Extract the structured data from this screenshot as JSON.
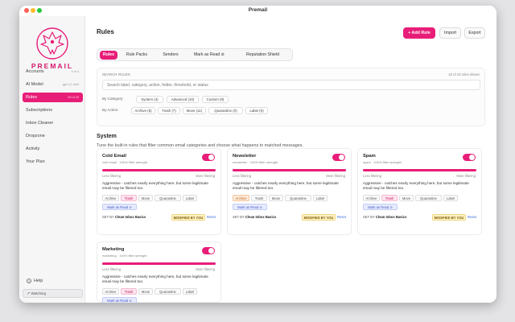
{
  "window": {
    "title": "Premail"
  },
  "colors": {
    "accent": "#e81d78",
    "toggle_on": "#e81d78",
    "link": "#3a6fd6",
    "modified_badge": "#fff3c6"
  },
  "sidebar": {
    "logo_text": "PREMAIL",
    "items": [
      {
        "label": "Accounts",
        "sub": "4 of 4",
        "active": false
      },
      {
        "label": "AI Model",
        "sub": "gpt-4.1-mini",
        "active": false
      },
      {
        "label": "Rules",
        "sub": "23 of 23",
        "active": true
      },
      {
        "label": "Subscriptions",
        "sub": "",
        "active": false
      },
      {
        "label": "Inbox Cleaner",
        "sub": "",
        "active": false
      },
      {
        "label": "Dropzone",
        "sub": "",
        "active": false
      },
      {
        "label": "Activity",
        "sub": "",
        "active": false
      },
      {
        "label": "Your Plan",
        "sub": "",
        "active": false
      }
    ],
    "help_label": "Help",
    "help_icon": "?",
    "status_text": "Watching"
  },
  "header": {
    "title": "Rules",
    "add_rule_label": "+ Add Rule",
    "import_label": "Import",
    "export_label": "Export"
  },
  "tabs": [
    {
      "label": "Rules",
      "active": true
    },
    {
      "label": "Rule Packs",
      "active": false
    },
    {
      "label": "Senders",
      "active": false
    },
    {
      "label": "Mark as Read ⊘",
      "active": false
    },
    {
      "label": "Reputation Shield",
      "active": false
    }
  ],
  "search": {
    "label": "SEARCH RULES",
    "count_text": "23 of 23 rules shown",
    "placeholder": "Search label, category, action, folder, threshold, or status"
  },
  "filters": {
    "category_label": "By Category:",
    "categories": [
      "System (4)",
      "Advanced (10)",
      "Custom (9)"
    ],
    "action_label": "By Action:",
    "actions": [
      "Archive (5)",
      "Trash (7)",
      "Move (11)",
      "Quarantine (0)",
      "Label (0)"
    ]
  },
  "section": {
    "title": "System",
    "description": "Tune the built-in rules that filter common email categories and choose what happens to matched messages."
  },
  "cards": [
    {
      "title": "Cold Email",
      "subtitle": "cold email · 100% filter strength",
      "enabled": true,
      "strength": 1.0,
      "slider_left": "Less filtering",
      "slider_right": "More filtering",
      "description": "Aggressive - catches nearly everything here, but some legitimate email may be filtered too.",
      "actions": [
        {
          "label": "Archive",
          "style": ""
        },
        {
          "label": "Trash",
          "style": "red"
        },
        {
          "label": "Move",
          "style": ""
        },
        {
          "label": "Quarantine",
          "style": ""
        },
        {
          "label": "Label",
          "style": ""
        }
      ],
      "mark_read": "Mark as Read ⊘",
      "set_by_label": "SET BY",
      "set_by_value": "Clean Inbox Basics",
      "modified_label": "MODIFIED BY YOU",
      "reset_label": "Reset"
    },
    {
      "title": "Newsletter",
      "subtitle": "newsletter · 100% filter strength",
      "enabled": true,
      "strength": 1.0,
      "slider_left": "Less filtering",
      "slider_right": "More filtering",
      "description": "Aggressive - catches nearly everything here, but some legitimate email may be filtered too.",
      "actions": [
        {
          "label": "Archive",
          "style": "orange"
        },
        {
          "label": "Trash",
          "style": ""
        },
        {
          "label": "Move",
          "style": ""
        },
        {
          "label": "Quarantine",
          "style": ""
        },
        {
          "label": "Label",
          "style": ""
        }
      ],
      "mark_read": "Mark as Read ⊘",
      "set_by_label": "SET BY",
      "set_by_value": "Clean Inbox Basics",
      "modified_label": "MODIFIED BY YOU",
      "reset_label": "Reset"
    },
    {
      "title": "Spam",
      "subtitle": "spam · 100% filter strength",
      "enabled": true,
      "strength": 1.0,
      "slider_left": "Less filtering",
      "slider_right": "More filtering",
      "description": "Aggressive - catches nearly everything here, but some legitimate email may be filtered too.",
      "actions": [
        {
          "label": "Archive",
          "style": ""
        },
        {
          "label": "Trash",
          "style": "red"
        },
        {
          "label": "Move",
          "style": ""
        },
        {
          "label": "Quarantine",
          "style": ""
        },
        {
          "label": "Label",
          "style": ""
        }
      ],
      "mark_read": "Mark as Read ⊘",
      "set_by_label": "SET BY",
      "set_by_value": "Clean Inbox Basics",
      "modified_label": "MODIFIED BY YOU",
      "reset_label": "Reset"
    },
    {
      "title": "Marketing",
      "subtitle": "marketing · 100% filter strength",
      "enabled": true,
      "strength": 1.0,
      "slider_left": "Less filtering",
      "slider_right": "More filtering",
      "description": "Aggressive - catches nearly everything here, but some legitimate email may be filtered too.",
      "actions": [
        {
          "label": "Archive",
          "style": ""
        },
        {
          "label": "Trash",
          "style": "red"
        },
        {
          "label": "Move",
          "style": ""
        },
        {
          "label": "Quarantine",
          "style": ""
        },
        {
          "label": "Label",
          "style": ""
        }
      ],
      "mark_read": "Mark as Read ⊘"
    }
  ]
}
